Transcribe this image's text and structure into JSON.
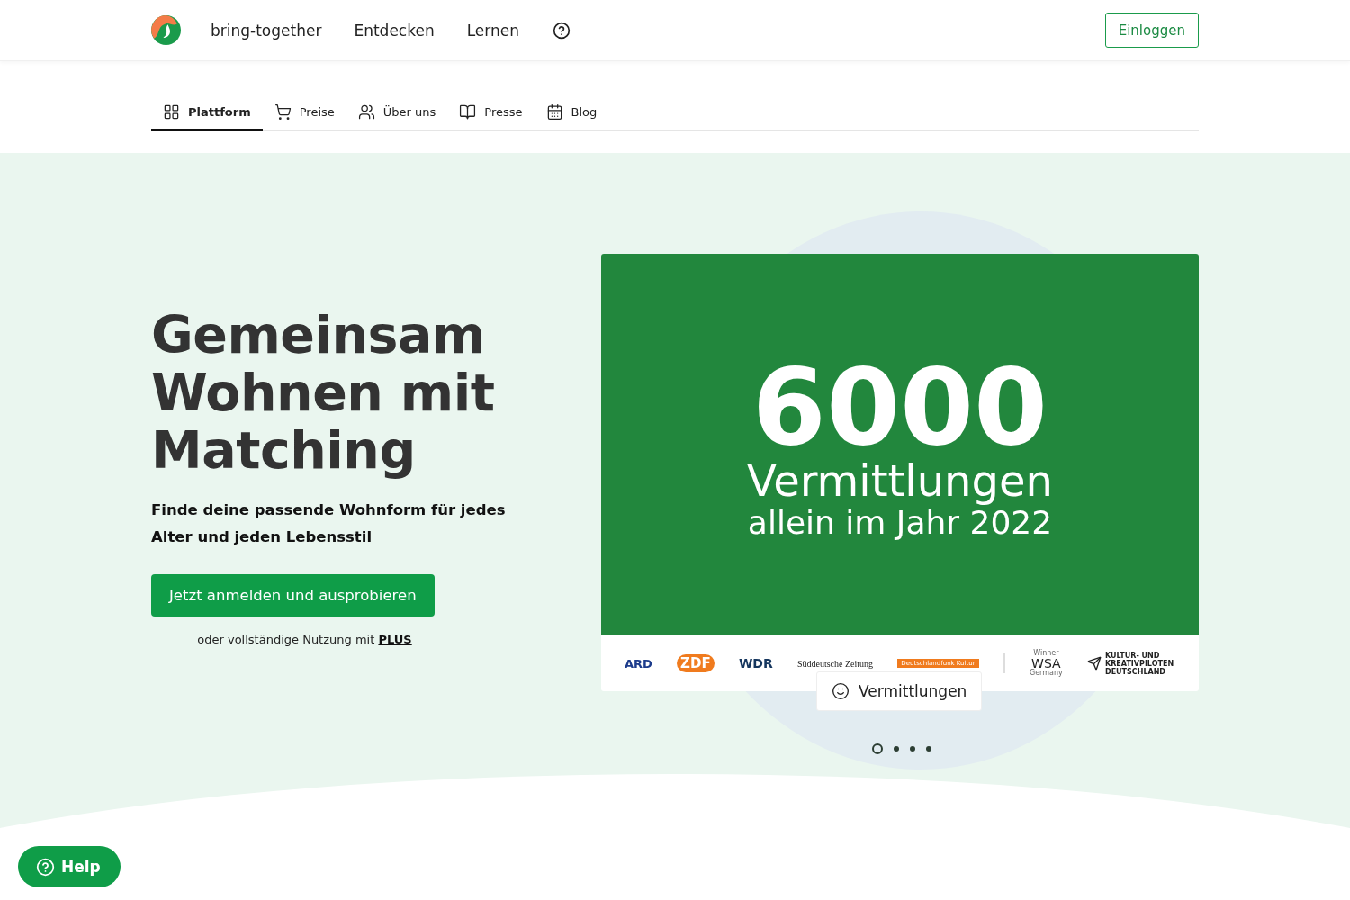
{
  "header": {
    "brand": "bring-together",
    "nav": [
      "Entdecken",
      "Lernen"
    ],
    "login": "Einloggen"
  },
  "subnav": [
    {
      "label": "Plattform",
      "selected": true
    },
    {
      "label": "Preise",
      "selected": false
    },
    {
      "label": "Über uns",
      "selected": false
    },
    {
      "label": "Presse",
      "selected": false
    },
    {
      "label": "Blog",
      "selected": false
    }
  ],
  "hero": {
    "title": "Gemeinsam Wohnen mit Matching",
    "subtitle": "Finde deine passende Wohnform für jedes Alter und jeden Lebensstil",
    "cta": "Jetzt anmelden und ausprobieren",
    "note": "oder vollständige Nutzung mit",
    "note_link": "PLUS"
  },
  "slide": {
    "number": "6000",
    "line1": "Vermittlungen",
    "line2": "allein im Jahr 2022",
    "badge": "Vermittlungen"
  },
  "press": [
    {
      "kind": "ard",
      "text": "ARD"
    },
    {
      "kind": "zdf",
      "text": "ZDF"
    },
    {
      "kind": "wdr",
      "text": "WDR"
    },
    {
      "kind": "sz",
      "text": "Süddeutsche Zeitung"
    },
    {
      "kind": "dlf",
      "text": "Deutschlandfunk Kultur"
    },
    {
      "kind": "divider"
    },
    {
      "kind": "wsa",
      "top": "Winner",
      "text": "WSA",
      "bottom": "Germany"
    },
    {
      "kind": "kkp",
      "text": "KULTUR- UND KREATIVPILOTEN DEUTSCHLAND"
    }
  ],
  "dots": [
    {
      "selected": true
    },
    {
      "selected": false
    },
    {
      "selected": false
    },
    {
      "selected": false
    }
  ],
  "help": "Help"
}
